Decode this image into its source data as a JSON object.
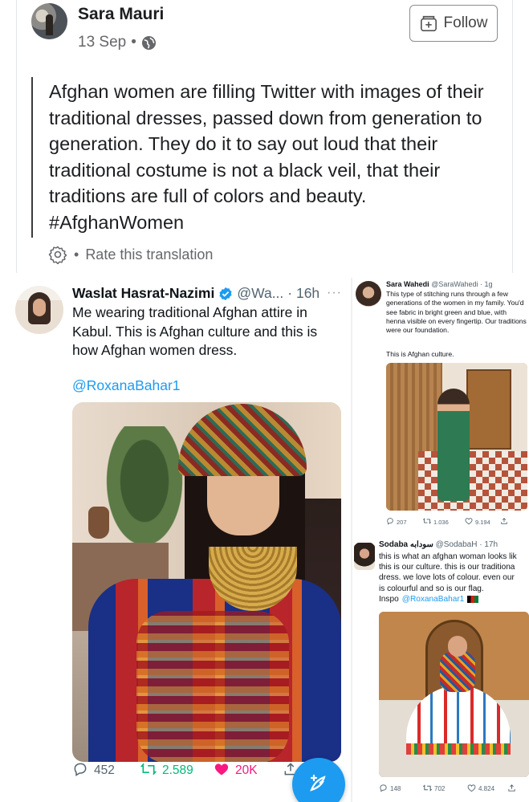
{
  "post": {
    "author": "Sara Mauri",
    "date": "13 Sep",
    "separator": "•",
    "follow_label": "Follow",
    "text": "Afghan women are filling Twitter with images of their traditional dresses, passed down from generation to generation. They do it to say out loud that their traditional costume is not a black veil, that their traditions are full of colors and beauty. #AfghanWomen",
    "translate_separator": "•",
    "translate_label": "Rate this translation"
  },
  "tweet_main": {
    "name": "Waslat Hasrat-Nazimi",
    "handle": "@Wa...",
    "time": "· 16h",
    "more": "···",
    "text": "Me wearing traditional Afghan attire in Kabul. This is Afghan culture and this is how Afghan women dress.",
    "mention": "@RoxanaBahar1",
    "replies": "452",
    "retweets": "2.589",
    "likes": "20K"
  },
  "tweet_right_1": {
    "name": "Sara Wahedi",
    "handle": "@SaraWahedi · 1g",
    "text": "This type of stitching runs through a few generations of the women in my family. You'd see fabric in bright green and blue, with henna visible on every fingertip. Our traditions were our foundation.",
    "text2": "This is Afghan culture.",
    "replies": "207",
    "retweets": "1.036",
    "likes": "9.194"
  },
  "tweet_right_2": {
    "name": "Sodaba سودابه",
    "handle": "@SodabaH · 17h",
    "lines": [
      "this is what an afghan woman looks lik",
      "this is our culture. this is our traditiona",
      "dress. we love lots of colour. even our",
      "is colourful and so is our flag."
    ],
    "inspo_label": "Inspo",
    "inspo_mention": "@RoxanaBahar1",
    "replies": "148",
    "retweets": "702",
    "likes": "4.824"
  },
  "colors": {
    "twitter_blue": "#1d9bf0",
    "retweet_green": "#00ba7c",
    "like_pink": "#f91880",
    "muted_text": "#65676b"
  },
  "icons": [
    "globe-icon",
    "follow-icon",
    "gear-icon",
    "verified-icon",
    "reply-icon",
    "retweet-icon",
    "heart-icon",
    "share-icon",
    "compose-icon",
    "afghan-flag-icon"
  ]
}
